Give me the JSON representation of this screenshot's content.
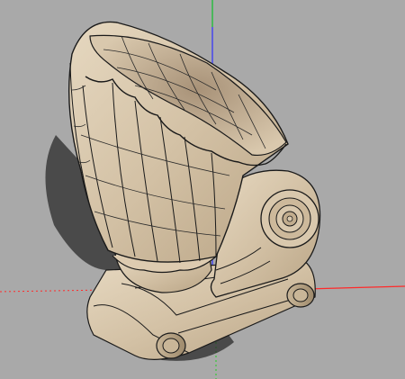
{
  "viewport": {
    "background_color": "#a9a9a9",
    "axes": {
      "red_axis_color": "#ff2a2a",
      "green_axis_color": "#1fcf1f",
      "blue_axis_color": "#2f2fff",
      "dotted": true
    },
    "model": {
      "name": "ionic-volute-shell-capital",
      "material_color": "#d8c7ad",
      "edge_color": "#1a1a1a",
      "shadow_color": "#2a2a2a"
    }
  }
}
